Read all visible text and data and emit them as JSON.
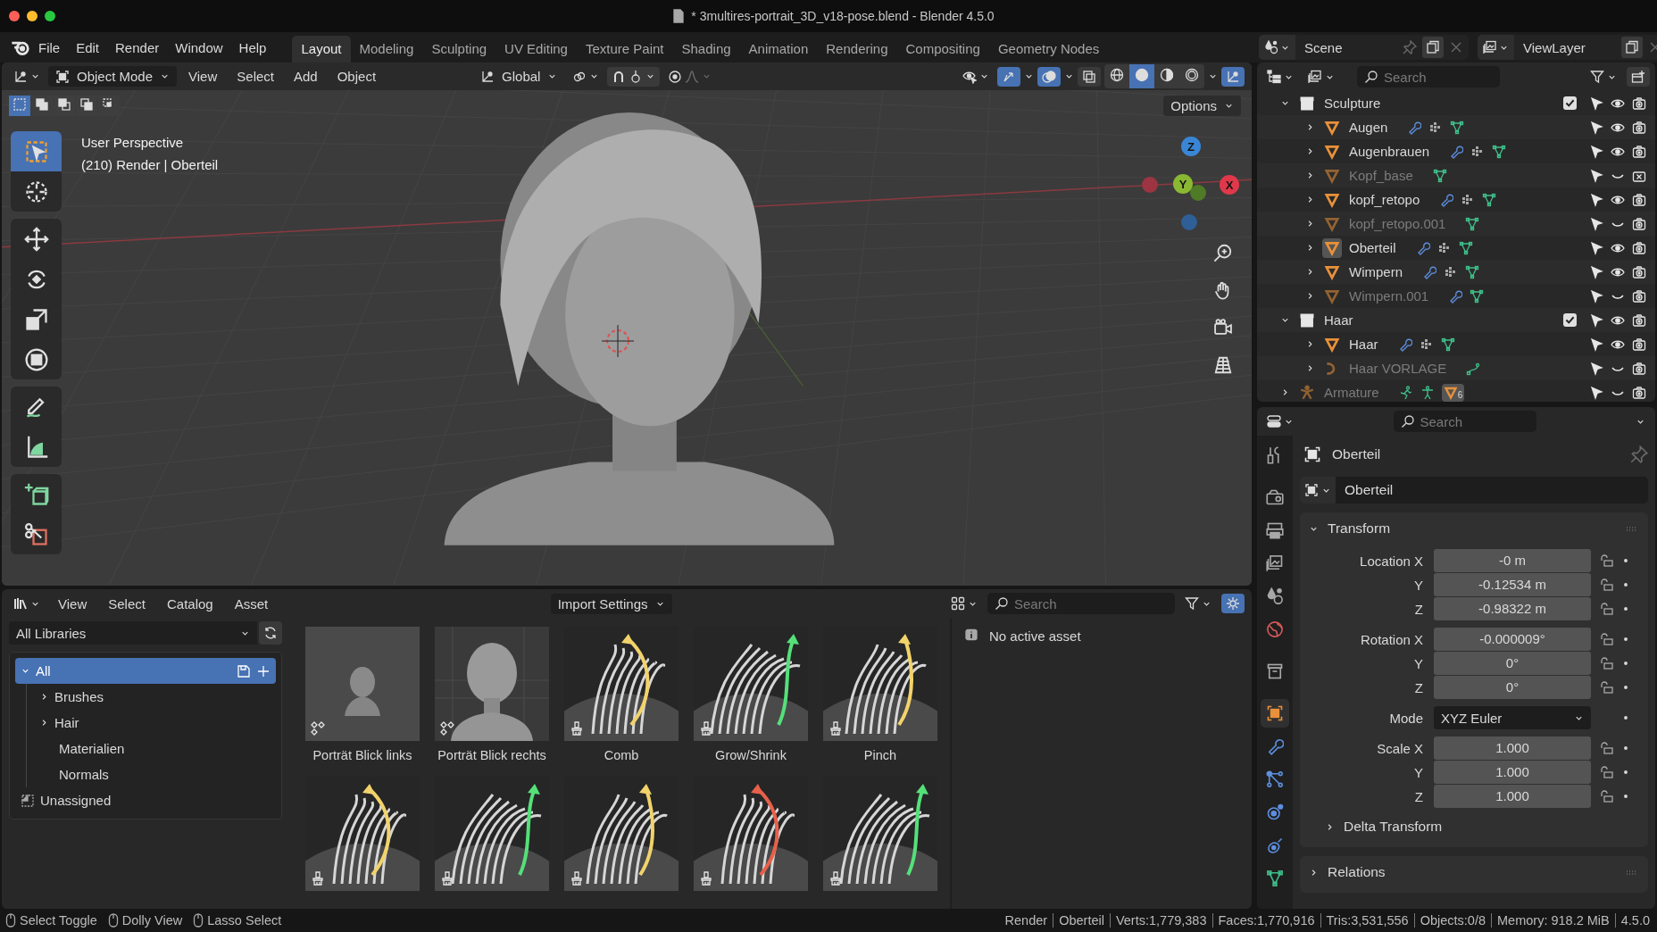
{
  "window": {
    "title": "* 3multires-portrait_3D_v18-pose.blend - Blender 4.5.0"
  },
  "menu": [
    "File",
    "Edit",
    "Render",
    "Window",
    "Help"
  ],
  "workspaces": [
    {
      "label": "Layout",
      "selected": true
    },
    {
      "label": "Modeling",
      "selected": false
    },
    {
      "label": "Sculpting",
      "selected": false
    },
    {
      "label": "UV Editing",
      "selected": false
    },
    {
      "label": "Texture Paint",
      "selected": false
    },
    {
      "label": "Shading",
      "selected": false
    },
    {
      "label": "Animation",
      "selected": false
    },
    {
      "label": "Rendering",
      "selected": false
    },
    {
      "label": "Compositing",
      "selected": false
    },
    {
      "label": "Geometry Nodes",
      "selected": false
    }
  ],
  "scene": {
    "name": "Scene",
    "view_layer": "ViewLayer"
  },
  "viewport": {
    "mode": "Object Mode",
    "menus": [
      "View",
      "Select",
      "Add",
      "Object"
    ],
    "orientation": "Global",
    "shading": [
      {
        "kind": "wireframe",
        "selected": false
      },
      {
        "kind": "solid",
        "selected": true
      },
      {
        "kind": "material",
        "selected": false
      },
      {
        "kind": "rendered",
        "selected": false
      }
    ],
    "select_modes": [
      {
        "kind": "set",
        "selected": true
      },
      {
        "kind": "extend",
        "selected": false
      },
      {
        "kind": "subtract",
        "selected": false
      },
      {
        "kind": "invert",
        "selected": false
      },
      {
        "kind": "intersect",
        "selected": false
      }
    ],
    "options": "Options",
    "info": [
      "User Perspective",
      "(210) Render | Oberteil"
    ],
    "tool_groups": [
      {
        "tools": [
          {
            "kind": "select_box",
            "selected": true
          },
          {
            "kind": "cursor",
            "selected": false
          }
        ]
      },
      {
        "tools": [
          {
            "kind": "move",
            "selected": false
          },
          {
            "kind": "rotate",
            "selected": false
          },
          {
            "kind": "scale",
            "selected": false
          },
          {
            "kind": "transform",
            "selected": false
          }
        ]
      },
      {
        "tools": [
          {
            "kind": "annotate",
            "selected": false
          },
          {
            "kind": "measure",
            "selected": false
          }
        ]
      },
      {
        "tools": [
          {
            "kind": "add_cube",
            "selected": false
          },
          {
            "kind": "cut",
            "selected": false
          }
        ]
      }
    ],
    "axes": [
      {
        "color": "#9c3441"
      },
      {
        "color": "#2e5f97"
      },
      {
        "color": "#4f7a26"
      },
      {
        "label": "Y",
        "color": "#8ab833"
      },
      {
        "label": "Z",
        "color": "#3a86d6"
      },
      {
        "label": "X",
        "color": "#e0384a"
      }
    ]
  },
  "outliner": {
    "search_placeholder": "Search",
    "tree": [
      {
        "label": "Sculpture",
        "kind": "collection",
        "expanded": true,
        "checked": true,
        "hidden": false,
        "children": [
          {
            "label": "Augen",
            "kind": "mesh",
            "expanded": false,
            "hidden": false,
            "active": false,
            "renderable": true,
            "data": [
              {
                "kind": "modifier"
              },
              {
                "kind": "particles"
              },
              {
                "kind": "mesh"
              }
            ]
          },
          {
            "label": "Augenbrauen",
            "kind": "mesh",
            "expanded": false,
            "hidden": false,
            "active": false,
            "renderable": true,
            "data": [
              {
                "kind": "modifier"
              },
              {
                "kind": "particles"
              },
              {
                "kind": "mesh"
              }
            ]
          },
          {
            "label": "Kopf_base",
            "kind": "mesh",
            "expanded": false,
            "hidden": true,
            "active": false,
            "renderable": false,
            "data": [
              {
                "kind": "mesh"
              }
            ]
          },
          {
            "label": "kopf_retopo",
            "kind": "mesh",
            "expanded": false,
            "hidden": false,
            "active": false,
            "renderable": true,
            "data": [
              {
                "kind": "modifier"
              },
              {
                "kind": "particles"
              },
              {
                "kind": "mesh"
              }
            ]
          },
          {
            "label": "kopf_retopo.001",
            "kind": "mesh",
            "expanded": false,
            "hidden": true,
            "active": false,
            "renderable": true,
            "data": [
              {
                "kind": "mesh"
              }
            ]
          },
          {
            "label": "Oberteil",
            "kind": "mesh",
            "expanded": false,
            "hidden": false,
            "active": true,
            "renderable": true,
            "data": [
              {
                "kind": "modifier"
              },
              {
                "kind": "particles"
              },
              {
                "kind": "mesh"
              }
            ]
          },
          {
            "label": "Wimpern",
            "kind": "mesh",
            "expanded": false,
            "hidden": false,
            "active": false,
            "renderable": true,
            "data": [
              {
                "kind": "modifier"
              },
              {
                "kind": "particles"
              },
              {
                "kind": "mesh"
              }
            ]
          },
          {
            "label": "Wimpern.001",
            "kind": "mesh",
            "expanded": false,
            "hidden": true,
            "active": false,
            "renderable": true,
            "data": [
              {
                "kind": "modifier"
              },
              {
                "kind": "mesh"
              }
            ]
          }
        ]
      },
      {
        "label": "Haar",
        "kind": "collection",
        "expanded": true,
        "checked": true,
        "hidden": false,
        "children": [
          {
            "label": "Haar",
            "kind": "mesh",
            "expanded": false,
            "hidden": false,
            "active": false,
            "renderable": true,
            "data": [
              {
                "kind": "modifier"
              },
              {
                "kind": "particles"
              },
              {
                "kind": "mesh"
              }
            ]
          },
          {
            "label": "Haar VORLAGE",
            "kind": "curve",
            "expanded": false,
            "hidden": true,
            "active": false,
            "renderable": true,
            "data": [
              {
                "kind": "curve"
              }
            ]
          }
        ]
      },
      {
        "label": "Armature",
        "kind": "armature",
        "expanded": false,
        "hidden": true,
        "active": false,
        "renderable": true,
        "data": [
          {
            "kind": "pose"
          },
          {
            "kind": "armature"
          },
          {
            "kind": "child_mesh"
          }
        ],
        "child_count": "6"
      }
    ]
  },
  "properties": {
    "search_placeholder": "Search",
    "tabs": [
      {
        "kind": "tool",
        "selected": false
      },
      {
        "kind": "render",
        "selected": false
      },
      {
        "kind": "output",
        "selected": false
      },
      {
        "kind": "view_layer",
        "selected": false
      },
      {
        "kind": "scene",
        "selected": false
      },
      {
        "kind": "world",
        "selected": false
      },
      {
        "kind": "collection",
        "selected": false
      },
      {
        "kind": "object",
        "selected": true
      },
      {
        "kind": "modifiers",
        "selected": false
      },
      {
        "kind": "particles",
        "selected": false
      },
      {
        "kind": "physics",
        "selected": false
      },
      {
        "kind": "constraints",
        "selected": false
      },
      {
        "kind": "data",
        "selected": false
      }
    ],
    "object_name": "Oberteil",
    "datablock": "Oberteil",
    "panels": [
      {
        "label": "Transform",
        "expanded": true,
        "groups": [
          [
            {
              "label": "Location X",
              "value": "-0 m",
              "kind": "number"
            },
            {
              "label": "Y",
              "value": "-0.12534 m",
              "kind": "number"
            },
            {
              "label": "Z",
              "value": "-0.98322 m",
              "kind": "number"
            }
          ],
          [
            {
              "label": "Rotation X",
              "value": "-0.000009°",
              "kind": "number"
            },
            {
              "label": "Y",
              "value": "0°",
              "kind": "number"
            },
            {
              "label": "Z",
              "value": "0°",
              "kind": "number"
            }
          ],
          [
            {
              "label": "Mode",
              "value": "XYZ Euler",
              "kind": "dropdown"
            }
          ],
          [
            {
              "label": "Scale X",
              "value": "1.000",
              "kind": "number"
            },
            {
              "label": "Y",
              "value": "1.000",
              "kind": "number"
            },
            {
              "label": "Z",
              "value": "1.000",
              "kind": "number"
            }
          ]
        ],
        "children": [
          {
            "label": "Delta Transform",
            "expanded": false
          }
        ]
      },
      {
        "label": "Relations",
        "expanded": false
      }
    ]
  },
  "asset_browser": {
    "menus": [
      "View",
      "Select",
      "Catalog",
      "Asset"
    ],
    "import_settings": "Import Settings",
    "search_placeholder": "Search",
    "library": "All Libraries",
    "catalogs": [
      {
        "label": "All",
        "kind": "folder",
        "selected": true,
        "expanded": true,
        "children": [
          {
            "label": "Brushes",
            "kind": "folder",
            "selected": false,
            "expanded": false
          },
          {
            "label": "Hair",
            "kind": "folder",
            "selected": false,
            "expanded": false
          },
          {
            "label": "Materialien",
            "kind": "leaf",
            "selected": false
          },
          {
            "label": "Normals",
            "kind": "leaf",
            "selected": false
          }
        ]
      },
      {
        "label": "Unassigned",
        "kind": "unassigned",
        "selected": false
      }
    ],
    "assets": [
      {
        "label": "Porträt Blick links",
        "kind": "pose"
      },
      {
        "label": "Porträt Blick rechts",
        "kind": "pose"
      },
      {
        "label": "Comb",
        "kind": "brush"
      },
      {
        "label": "Grow/Shrink",
        "kind": "brush"
      },
      {
        "label": "Pinch",
        "kind": "brush"
      },
      {
        "kind": "brush"
      },
      {
        "kind": "brush"
      },
      {
        "kind": "brush"
      },
      {
        "kind": "brush"
      },
      {
        "kind": "brush"
      }
    ],
    "info": "No active asset"
  },
  "status_bar": {
    "hints": [
      "Select Toggle",
      "Dolly View",
      "Lasso Select"
    ],
    "stats": [
      "Render",
      "Oberteil",
      "Verts:1,779,383",
      "Faces:1,770,916",
      "Tris:3,531,556",
      "Objects:0/8",
      "Memory: 918.2 MiB",
      "4.5.0"
    ]
  }
}
